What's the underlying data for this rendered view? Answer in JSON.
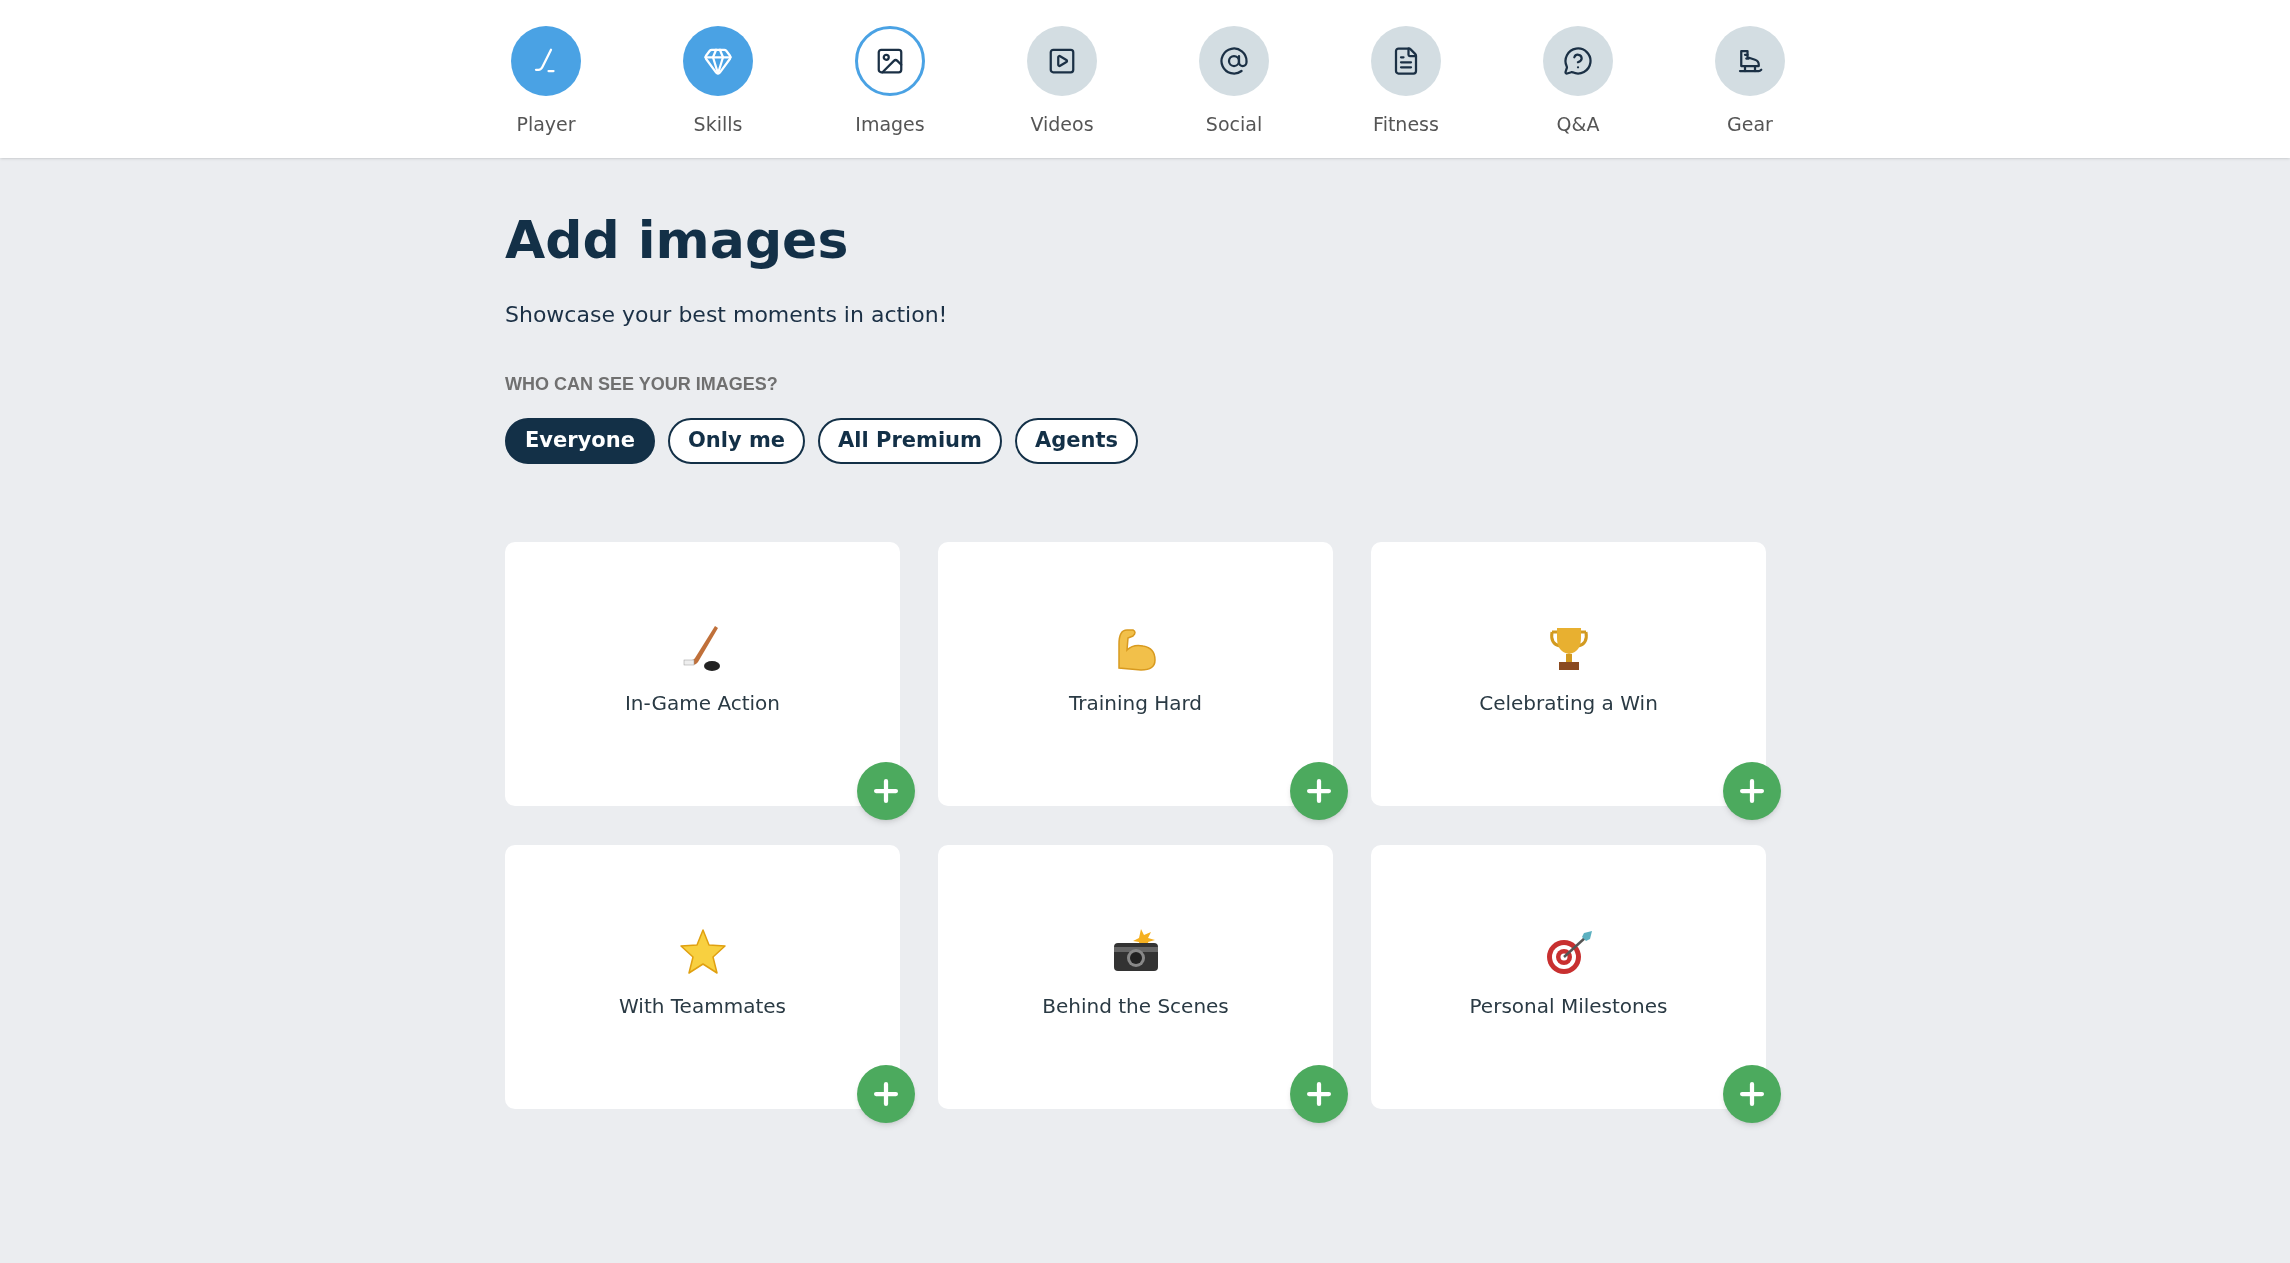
{
  "steps": [
    {
      "label": "Player",
      "done": true,
      "selected": false
    },
    {
      "label": "Skills",
      "done": true,
      "selected": false
    },
    {
      "label": "Images",
      "done": false,
      "selected": true
    },
    {
      "label": "Videos",
      "done": false,
      "selected": false
    },
    {
      "label": "Social",
      "done": false,
      "selected": false
    },
    {
      "label": "Fitness",
      "done": false,
      "selected": false
    },
    {
      "label": "Q&A",
      "done": false,
      "selected": false
    },
    {
      "label": "Gear",
      "done": false,
      "selected": false
    }
  ],
  "title": "Add images",
  "subtitle": "Showcase your best moments in action!",
  "visibility": {
    "label": "WHO CAN SEE YOUR IMAGES?",
    "options": [
      {
        "label": "Everyone",
        "selected": true
      },
      {
        "label": "Only me",
        "selected": false
      },
      {
        "label": "All Premium",
        "selected": false
      },
      {
        "label": "Agents",
        "selected": false
      }
    ]
  },
  "categories": [
    {
      "label": "In-Game Action"
    },
    {
      "label": "Training Hard"
    },
    {
      "label": "Celebrating a Win"
    },
    {
      "label": "With Teammates"
    },
    {
      "label": "Behind the Scenes"
    },
    {
      "label": "Personal Milestones"
    }
  ]
}
